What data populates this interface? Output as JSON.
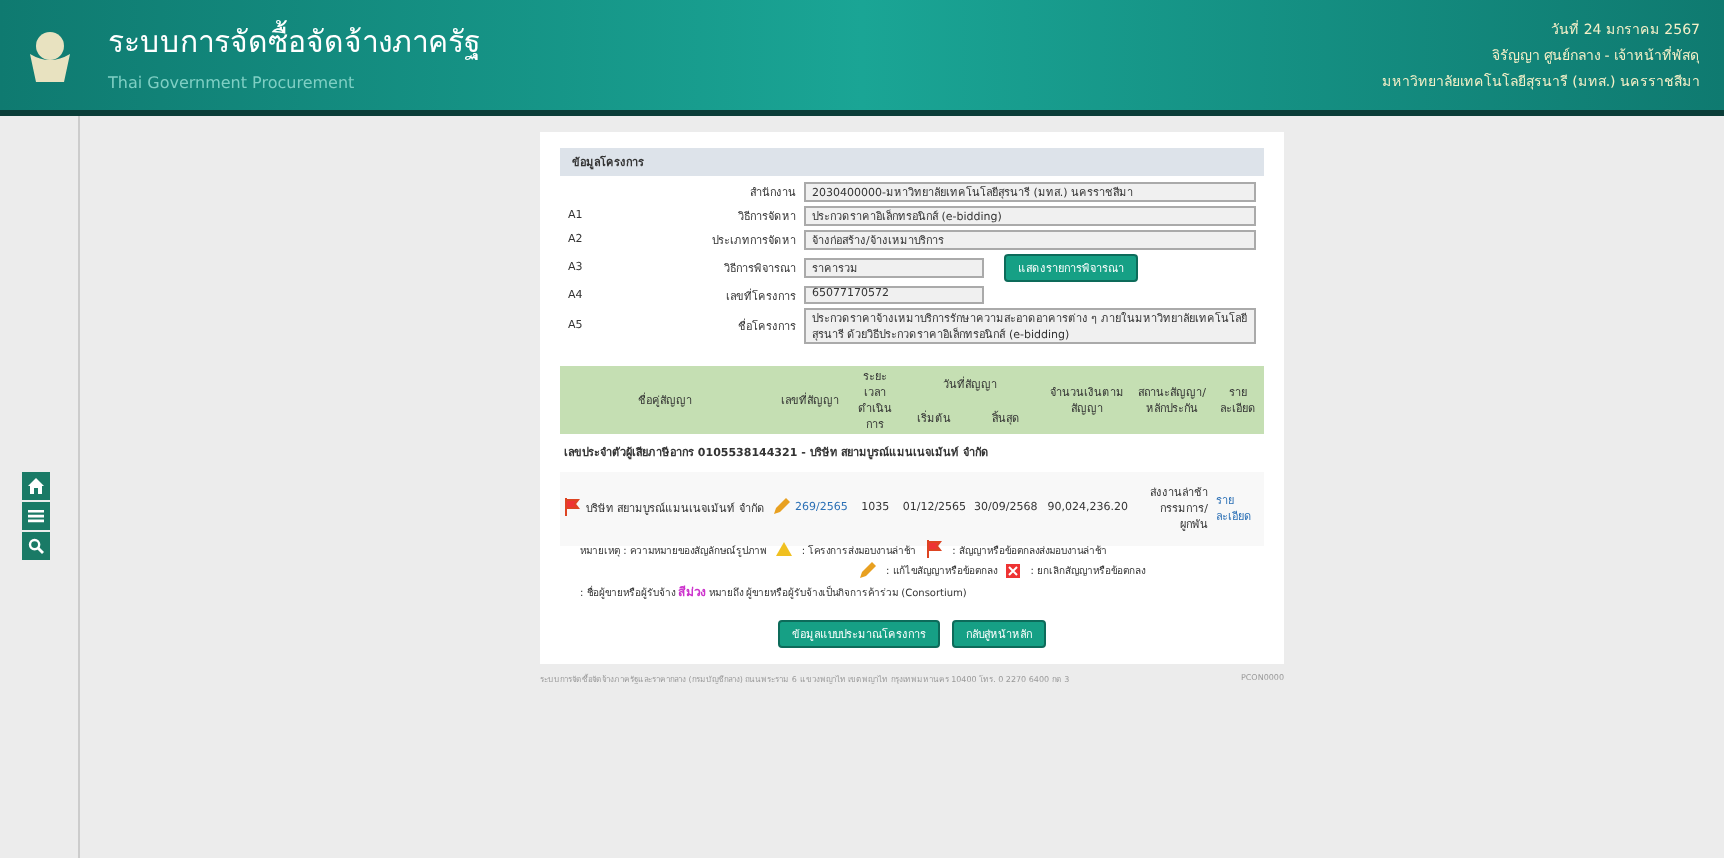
{
  "header": {
    "title": "ระบบการจัดซื้อจัดจ้างภาครัฐ",
    "subtitle": "Thai Government Procurement",
    "date": "วันที่ 24 มกราคม 2567",
    "user": "จิรัญญา ศูนย์กลาง - เจ้าหน้าที่พัสดุ",
    "agency": "มหาวิทยาลัยเทคโนโลยีสุรนารี (มทส.) นครราชสีมา"
  },
  "side_buttons": [
    {
      "kind": "home"
    },
    {
      "kind": "menu"
    },
    {
      "kind": "search"
    }
  ],
  "project": {
    "section_title": "ข้อมูลโครงการ",
    "fields": [
      {
        "label": "สำนักงาน",
        "value": "2030400000-มหาวิทยาลัยเทคโนโลยีสุรนารี (มทส.) นครราชสีมา",
        "kind": "wide"
      },
      {
        "code": "A1",
        "label": "วิธีการจัดหา",
        "value": "ประกวดราคาอิเล็กทรอนิกส์ (e-bidding)",
        "kind": "wide"
      },
      {
        "code": "A2",
        "label": "ประเภทการจัดหา",
        "value": "จ้างก่อสร้าง/จ้างเหมาบริการ",
        "kind": "wide"
      },
      {
        "code": "A3",
        "label": "วิธีการพิจารณา",
        "value": "ราคารวม",
        "kind": "short",
        "button": "แสดงรายการพิจารณา"
      },
      {
        "code": "A4",
        "label": "เลขที่โครงการ",
        "value": "65077170572",
        "kind": "short"
      },
      {
        "code": "A5",
        "label": "ชื่อโครงการ",
        "value": "ประกวดราคาจ้างเหมาบริการรักษาความสะอาดอาคารต่าง ๆ ภายในมหาวิทยาลัยเทคโนโลยีสุรนารี ด้วยวิธีประกวดราคาอิเล็กทรอนิกส์ (e-bidding)",
        "kind": "area"
      }
    ]
  },
  "contracts": {
    "columns": [
      "ชื่อคู่สัญญา",
      "เลขที่สัญญา",
      "ระยะเวลาดำเนินการ",
      "วันที่สัญญา",
      "จำนวนเงินตามสัญญา",
      "สถานะสัญญา/หลักประกัน",
      "รายละเอียด"
    ],
    "date_columns": [
      "เริ่มต้น",
      "สิ้นสุด"
    ],
    "group": "เลขประจำตัวผู้เสียภาษีอากร 0105538144321 - บริษัท สยามบูรณ์แมนเนจเม้นท์ จำกัด",
    "rows": [
      {
        "late": true,
        "edited": true,
        "vendor": "บริษัท สยามบูรณ์แมนเนจเม้นท์ จำกัด",
        "number": "269/2565",
        "duration": "1035",
        "start": "01/12/2565",
        "end": "30/09/2568",
        "amount": "90,024,236.20",
        "status": "ส่งงานล่าช้า กรรมการ/ ผูกพัน",
        "detail": "รายละเอียด"
      }
    ]
  },
  "legend": {
    "title": "หมายเหตุ : ความหมายของสัญลักษณ์รูปภาพ",
    "items": [
      {
        "kind": "warning",
        "text": ": โครงการส่งมอบงานล่าช้า"
      },
      {
        "kind": "flag",
        "text": ": สัญญาหรือข้อตกลงส่งมอบงานล่าช้า"
      },
      {
        "kind": "pencil",
        "text": ": แก้ไขสัญญาหรือข้อตกลง"
      },
      {
        "kind": "cancel",
        "text": ": ยกเลิกสัญญาหรือข้อตกลง"
      }
    ],
    "note_before": ": ชื่อผู้ขายหรือผู้รับจ้าง",
    "note_color_word": "สีม่วง",
    "color": "#cc33cc",
    "note_after": "หมายถึง ผู้ขายหรือผู้รับจ้างเป็นกิจการค้าร่วม (Consortium)"
  },
  "buttons": [
    "ข้อมูลแบบประมาณโครงการ",
    "กลับสู่หน้าหลัก"
  ],
  "footer": {
    "text": "ระบบการจัดซื้อจัดจ้างภาครัฐและราคากลาง (กรมบัญชีกลาง) ถนนพระราม 6 แขวงพญาไท เขตพญาไท กรุงเทพมหานคร 10400 โทร. 0 2270 6400 กด 3",
    "code": "PCON0000"
  }
}
